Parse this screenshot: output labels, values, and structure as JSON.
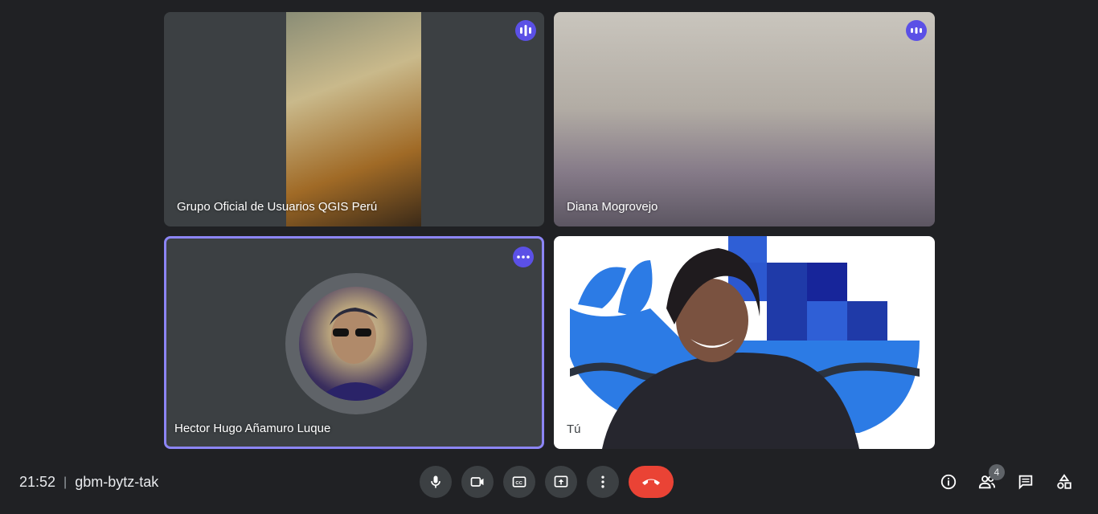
{
  "meeting": {
    "time": "21:52",
    "separator": "|",
    "code": "gbm-bytz-tak"
  },
  "participants": [
    {
      "name": "Grupo Oficial de Usuarios QGIS Perú",
      "status_icon": "audio-bars-icon"
    },
    {
      "name": "Diana Mogrovejo",
      "status_icon": "audio-bars-icon"
    },
    {
      "name": "Hector Hugo Añamuro Luque",
      "status_icon": "more-dots-icon"
    },
    {
      "name": "Tú"
    }
  ],
  "toolbar": {
    "mic": "mic-icon",
    "camera": "camera-icon",
    "captions": "captions-icon",
    "present": "present-screen-icon",
    "more": "more-options-icon",
    "end_call": "end-call-icon"
  },
  "side_controls": {
    "info": "info-icon",
    "people": "people-icon",
    "people_count": "4",
    "chat": "chat-icon",
    "activities": "activities-icon"
  },
  "colors": {
    "background": "#202124",
    "tile": "#3c4043",
    "accent": "#5b50e6",
    "end_call": "#ea4335"
  }
}
